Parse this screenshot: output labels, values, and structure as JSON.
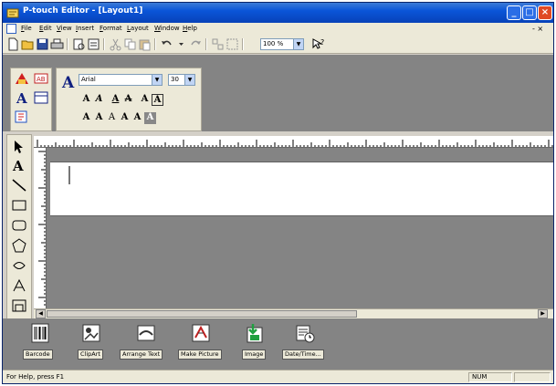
{
  "window": {
    "title": "P-touch Editor - [Layout1]",
    "title_color": "#0a55d8"
  },
  "menubar": {
    "items": [
      "File",
      "Edit",
      "View",
      "Insert",
      "Format",
      "Layout",
      "Window",
      "Help"
    ],
    "mdi_controls": "- ×"
  },
  "toolbar": {
    "zoom_value": "100 %",
    "buttons": [
      "new-icon",
      "open-icon",
      "save-icon",
      "print-icon",
      "print-preview-icon",
      "cut-icon",
      "copy-icon",
      "paste-icon",
      "undo-icon",
      "redo-icon",
      "group-icon",
      "ungroup-icon",
      "help-pointer-icon"
    ]
  },
  "property_dock": {
    "font_name": "Arial",
    "font_size": "30",
    "style_buttons": [
      "A",
      "A",
      "A",
      "A",
      "A",
      "A",
      "A",
      "A",
      "A",
      "A",
      "A",
      "A"
    ]
  },
  "object_dock": {
    "items": [
      {
        "label": "Barcode",
        "icon": "barcode-icon"
      },
      {
        "label": "ClipArt",
        "icon": "clipart-icon"
      },
      {
        "label": "Arrange Text",
        "icon": "arrange-text-icon"
      },
      {
        "label": "Make Picture",
        "icon": "make-picture-icon"
      },
      {
        "label": "Image",
        "icon": "image-icon"
      },
      {
        "label": "Date/Time...",
        "icon": "date-time-icon"
      }
    ]
  },
  "statusbar": {
    "help_text": "For Help, press F1",
    "num_indicator": "NUM"
  }
}
